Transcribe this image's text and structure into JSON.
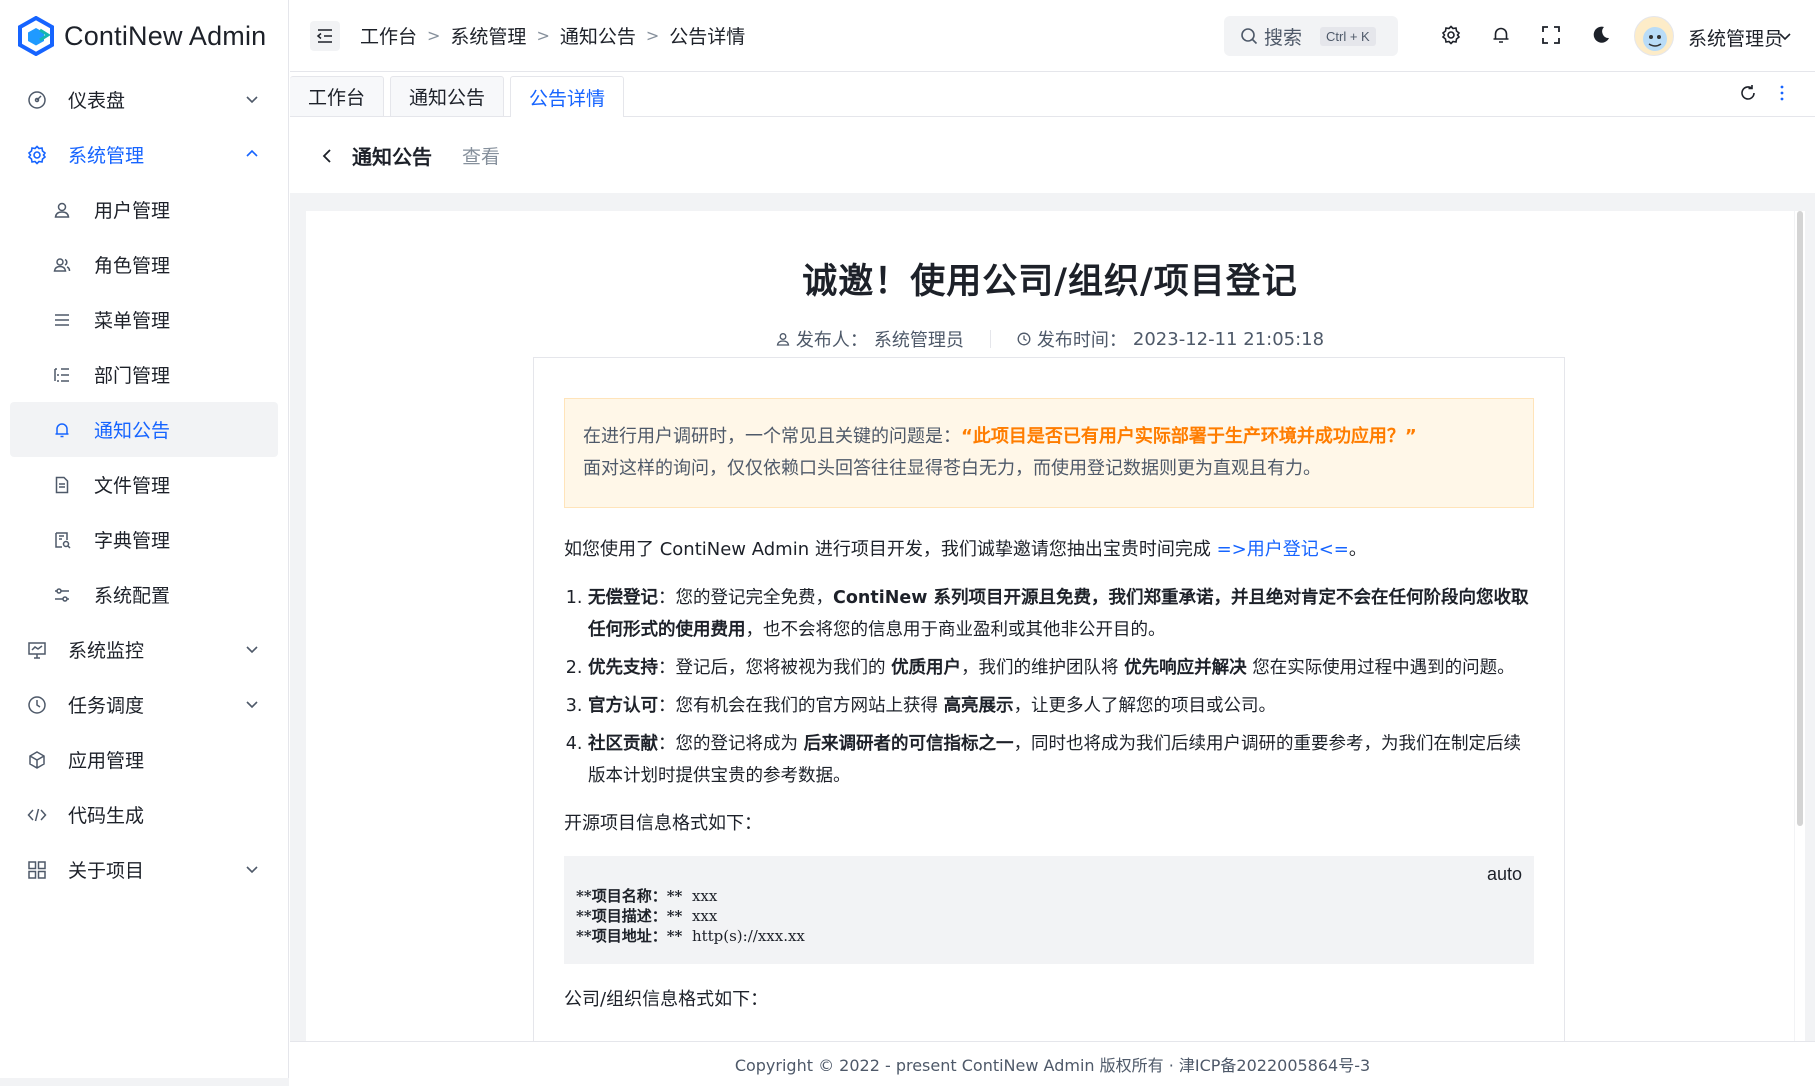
{
  "app": {
    "name": "ContiNew Admin"
  },
  "sidebar": {
    "items": [
      {
        "label": "仪表盘",
        "icon": "dashboard-icon"
      },
      {
        "label": "系统管理",
        "icon": "gear-icon",
        "open": true,
        "children": [
          {
            "label": "用户管理",
            "icon": "user-icon"
          },
          {
            "label": "角色管理",
            "icon": "users-icon"
          },
          {
            "label": "菜单管理",
            "icon": "menu-icon"
          },
          {
            "label": "部门管理",
            "icon": "tree-list-icon"
          },
          {
            "label": "通知公告",
            "icon": "bell-icon",
            "active": true
          },
          {
            "label": "文件管理",
            "icon": "file-icon"
          },
          {
            "label": "字典管理",
            "icon": "dictionary-icon"
          },
          {
            "label": "系统配置",
            "icon": "sliders-icon"
          }
        ]
      },
      {
        "label": "系统监控",
        "icon": "monitor-icon"
      },
      {
        "label": "任务调度",
        "icon": "clock-icon"
      },
      {
        "label": "应用管理",
        "icon": "cube-icon"
      },
      {
        "label": "代码生成",
        "icon": "code-icon"
      },
      {
        "label": "关于项目",
        "icon": "grid-icon"
      }
    ]
  },
  "header": {
    "breadcrumb": [
      "工作台",
      "系统管理",
      "通知公告",
      "公告详情"
    ],
    "search_label": "搜索",
    "search_shortcut": "Ctrl + K",
    "username": "系统管理员"
  },
  "tabs": [
    "工作台",
    "通知公告",
    "公告详情"
  ],
  "page": {
    "title": "通知公告",
    "subtitle": "查看"
  },
  "notice": {
    "title": "诚邀！使用公司/组织/项目登记",
    "publisher_label": "发布人：",
    "publisher": "系统管理员",
    "time_label": "发布时间：",
    "time": "2023-12-11 21:05:18",
    "callout_prefix": "在进行用户调研时，一个常见且关键的问题是：",
    "callout_highlight": "“此项目是否已有用户实际部署于生产环境并成功应用？”",
    "callout_line2": "面对这样的询问，仅仅依赖口头回答往往显得苍白无力，而使用登记数据则更为直观且有力。",
    "intro_prefix": "如您使用了 ContiNew Admin 进行项目开发，我们诚挚邀请您抽出宝贵时间完成 ",
    "intro_link": "=>用户登记<=",
    "intro_suffix": "。",
    "list": [
      {
        "head": "无偿登记",
        "p1": "：您的登记完全免费，",
        "b1": "ContiNew 系列项目开源且免费，我们郑重承诺，并且绝对肯定不会在任何阶段向您收取任何形式的使用费用",
        "p2": "，也不会将您的信息用于商业盈利或其他非公开目的。"
      },
      {
        "head": "优先支持",
        "p1": "：登记后，您将被视为我们的 ",
        "b1": "优质用户",
        "p2": "，我们的维护团队将 ",
        "b2": "优先响应并解决",
        "p3": " 您在实际使用过程中遇到的问题。"
      },
      {
        "head": "官方认可",
        "p1": "：您有机会在我们的官方网站上获得 ",
        "b1": "高亮展示",
        "p2": "，让更多人了解您的项目或公司。"
      },
      {
        "head": "社区贡献",
        "p1": "：您的登记将成为 ",
        "b1": "后来调研者的可信指标之一",
        "p2": "，同时也将成为我们后续用户调研的重要参考，为我们在制定后续版本计划时提供宝贵的参考数据。"
      }
    ],
    "project_format_label": "开源项目信息格式如下：",
    "code_lang": "auto",
    "code_lines": [
      {
        "key": "**项目名称：**",
        "val": "xxx"
      },
      {
        "key": "**项目描述：**",
        "val": "xxx"
      },
      {
        "key": "**项目地址：**",
        "val": "http(s)://xxx.xx"
      }
    ],
    "org_format_label": "公司/组织信息格式如下："
  },
  "footer": {
    "text": "Copyright © 2022 - present ContiNew Admin 版权所有 · 津ICP备2022005864号-3"
  },
  "colors": {
    "primary": "#1664ff",
    "highlight": "#ff7d00",
    "callout_bg": "#fff7e8"
  }
}
